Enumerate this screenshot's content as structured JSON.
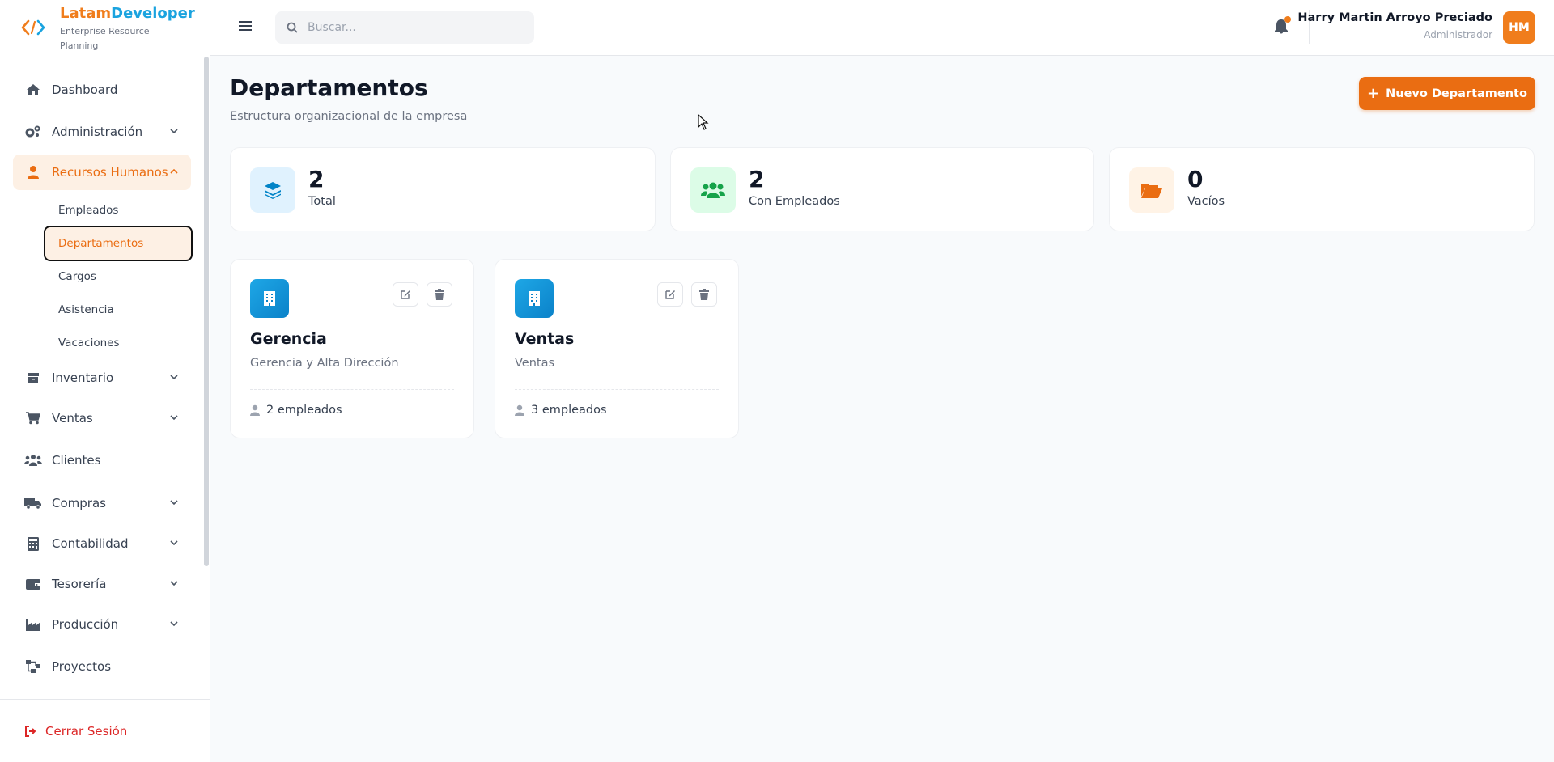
{
  "brand": {
    "name_part1": "Latam",
    "name_part2": "Developer",
    "subtitle": "Enterprise Resource Planning",
    "accent": "#f07d1c",
    "secondary": "#1aa3df"
  },
  "sidebar": {
    "items": [
      {
        "label": "Dashboard",
        "icon": "home-icon"
      },
      {
        "label": "Administración",
        "icon": "cogs-icon"
      },
      {
        "label": "Recursos Humanos",
        "icon": "user-icon"
      },
      {
        "label": "Inventario",
        "icon": "box-icon"
      },
      {
        "label": "Ventas",
        "icon": "cart-icon"
      },
      {
        "label": "Clientes",
        "icon": "users-icon"
      },
      {
        "label": "Compras",
        "icon": "truck-icon"
      },
      {
        "label": "Contabilidad",
        "icon": "calculator-icon"
      },
      {
        "label": "Tesorería",
        "icon": "wallet-icon"
      },
      {
        "label": "Producción",
        "icon": "factory-icon"
      },
      {
        "label": "Proyectos",
        "icon": "project-diagram-icon"
      }
    ],
    "hr_subitems": [
      "Empleados",
      "Departamentos",
      "Cargos",
      "Asistencia",
      "Vacaciones"
    ],
    "logout_label": "Cerrar Sesión"
  },
  "header": {
    "search_placeholder": "Buscar...",
    "user_name": "Harry Martin Arroyo Preciado",
    "user_role": "Administrador",
    "avatar_initials": "HM"
  },
  "main": {
    "title": "Departamentos",
    "subtitle": "Estructura organizacional de la empresa",
    "new_button_label": "Nuevo Departamento",
    "stats": [
      {
        "value": "2",
        "label": "Total"
      },
      {
        "value": "2",
        "label": "Con Empleados"
      },
      {
        "value": "0",
        "label": "Vacíos"
      }
    ],
    "departments": [
      {
        "name": "Gerencia",
        "description": "Gerencia y Alta Dirección",
        "employees": "2 empleados"
      },
      {
        "name": "Ventas",
        "description": "Ventas",
        "employees": "3 empleados"
      }
    ]
  }
}
